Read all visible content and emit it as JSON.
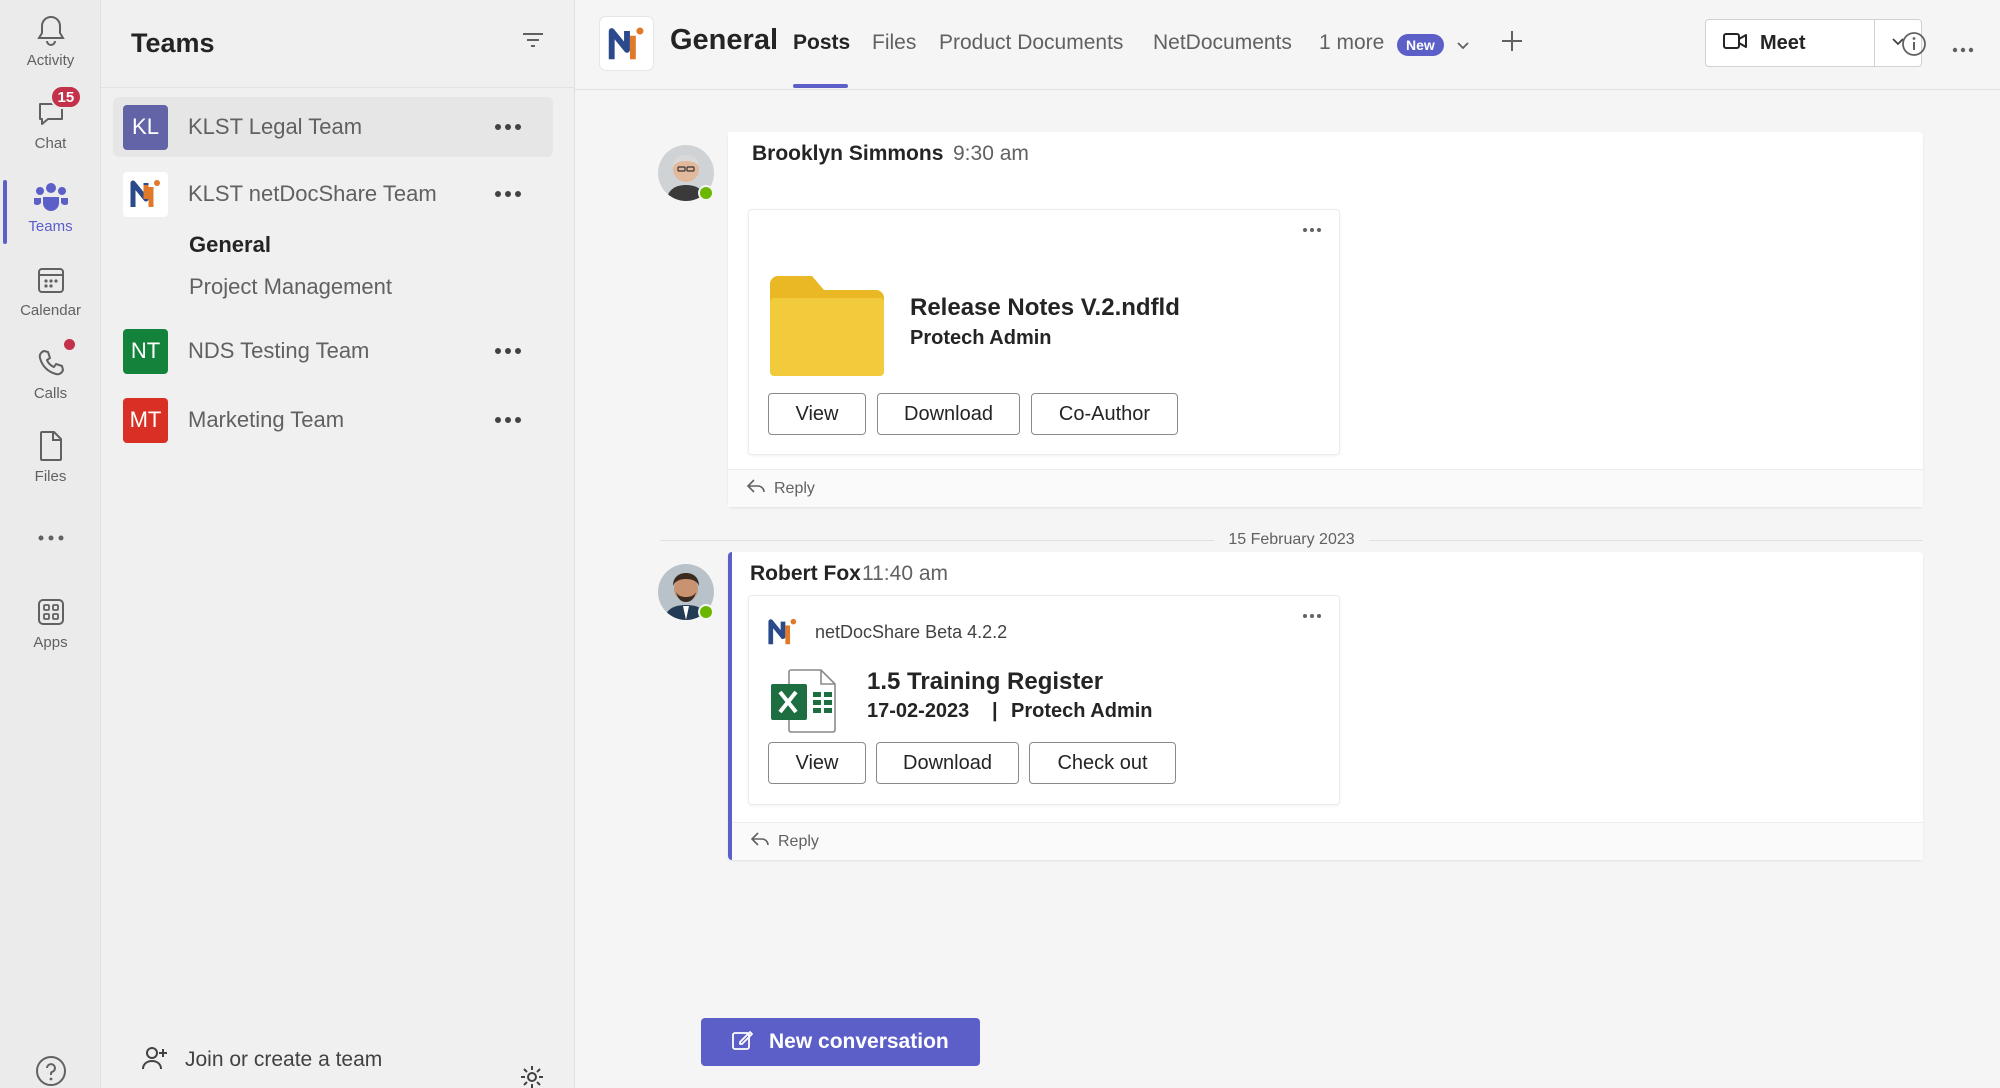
{
  "rail": {
    "items": [
      {
        "label": "Activity",
        "icon": "bell-icon"
      },
      {
        "label": "Chat",
        "icon": "chat-icon",
        "badge": "15"
      },
      {
        "label": "Teams",
        "icon": "teams-icon"
      },
      {
        "label": "Calendar",
        "icon": "calendar-icon"
      },
      {
        "label": "Calls",
        "icon": "phone-icon"
      },
      {
        "label": "Files",
        "icon": "file-icon"
      },
      {
        "label": "Apps",
        "icon": "apps-icon"
      }
    ],
    "active": "Teams"
  },
  "teams_panel": {
    "title": "Teams",
    "teams": [
      {
        "initials": "KL",
        "name": "KLST Legal Team",
        "color": "#6264a7"
      },
      {
        "initials": "",
        "name": "KLST netDocShare Team",
        "color": "#ffffff"
      },
      {
        "initials": "NT",
        "name": "NDS Testing Team",
        "color": "#13823b"
      },
      {
        "initials": "MT",
        "name": "Marketing Team",
        "color": "#d93025"
      }
    ],
    "channels": [
      "General",
      "Project Management"
    ],
    "footer_label": "Join or create a team"
  },
  "topbar": {
    "channel_title": "General",
    "tabs": [
      "Posts",
      "Files",
      "Product Documents",
      "NetDocuments",
      "1 more"
    ],
    "new_badge": "New",
    "meet_label": "Meet"
  },
  "posts": [
    {
      "author": "Brooklyn Simmons",
      "time": "9:30 am",
      "card": {
        "title": "Release Notes V.2.ndfld",
        "subtitle": "Protech Admin",
        "buttons": [
          "View",
          "Download",
          "Co-Author"
        ]
      },
      "reply_label": "Reply"
    },
    {
      "author": "Robert Fox",
      "time": "11:40 am",
      "card": {
        "bot_name": "netDocShare Beta 4.2.2",
        "title": "1.5 Training Register",
        "date": "17-02-2023",
        "separator": "|",
        "owner": "Protech Admin",
        "buttons": [
          "View",
          "Download",
          "Check out"
        ]
      },
      "reply_label": "Reply"
    }
  ],
  "date_divider": "15 February 2023",
  "new_conversation_label": "New conversation",
  "colors": {
    "accent": "#5b5fc7",
    "presence": "#6bb700",
    "badge": "#c4314b",
    "folder": "#f2cb3c",
    "excel": "#1d6f42"
  }
}
